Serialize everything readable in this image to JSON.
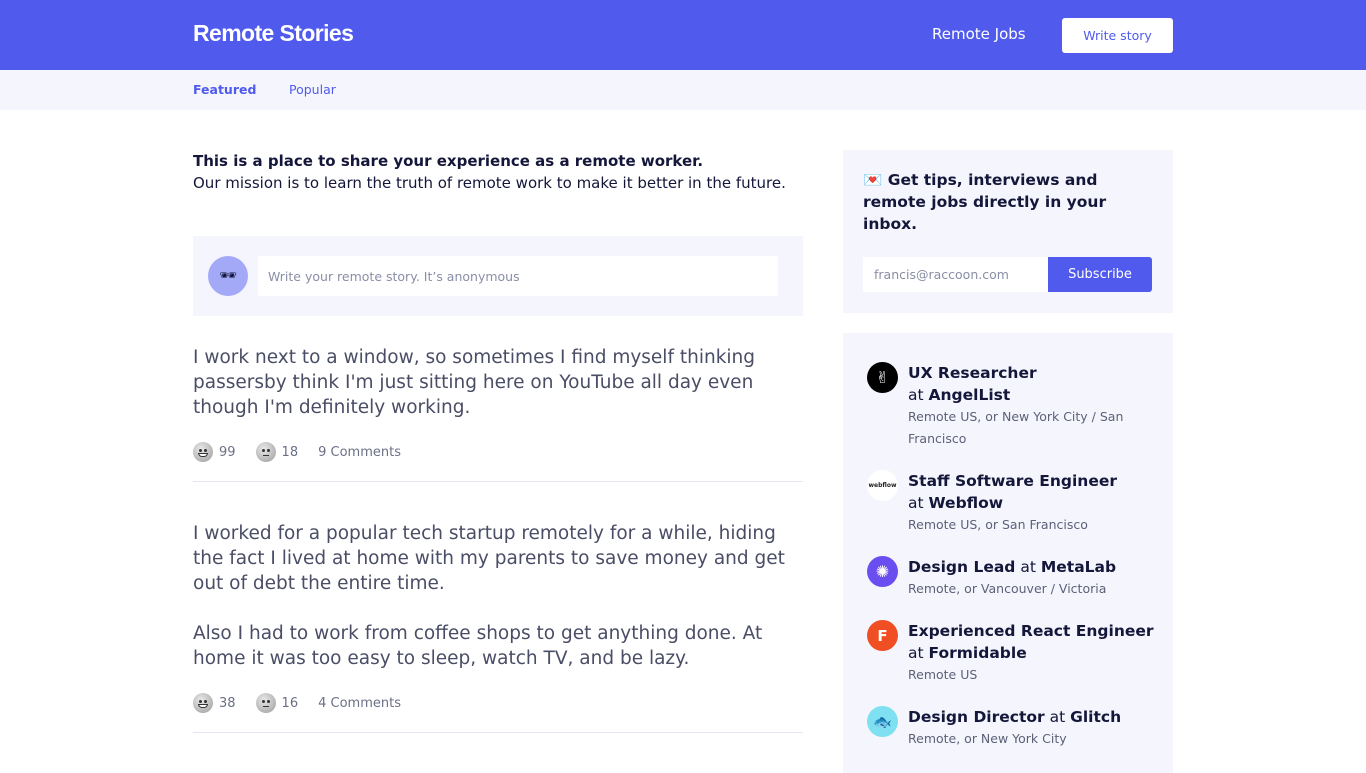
{
  "header": {
    "logo": "Remote Stories",
    "nav_jobs": "Remote Jobs",
    "write_story": "Write story",
    "brand_color": "#505bee"
  },
  "subnav": {
    "tabs": [
      {
        "label": "Featured",
        "active": true
      },
      {
        "label": "Popular",
        "active": false
      }
    ]
  },
  "intro": {
    "headline": "This is a place to share your experience as a remote worker.",
    "mission": "Our mission is to learn the truth of remote work to make it better in the future."
  },
  "composer": {
    "avatar_icon": "sunglasses-icon",
    "avatar_glyph": "🕶",
    "placeholder": "Write your remote story. It’s anonymous"
  },
  "stories": [
    {
      "paragraphs": [
        "I work next to a window, so sometimes I find myself thinking passersby think I'm just sitting here on YouTube all day even though I'm definitely working."
      ],
      "happy": "99",
      "meh": "18",
      "comments": "9 Comments"
    },
    {
      "paragraphs": [
        "I worked for a popular tech startup remotely for a while, hiding the fact I lived at home with my parents to save money and get out of debt the entire time.",
        "Also I had to work from coffee shops to get anything done. At home it was too easy to sleep, watch TV, and be lazy."
      ],
      "happy": "38",
      "meh": "16",
      "comments": "4 Comments"
    }
  ],
  "newsletter": {
    "icon": "love-letter-icon",
    "glyph": "💌",
    "heading": "Get tips, interviews and remote jobs directly in your inbox.",
    "email_placeholder": "francis@raccoon.com",
    "subscribe": "Subscribe"
  },
  "jobs": [
    {
      "role": "UX Researcher",
      "at": "at",
      "company": "AngelList",
      "location": "Remote US, or New York City / San Francisco",
      "logo_bg": "#000000",
      "logo_glyph": "✌"
    },
    {
      "role": "Staff Software Engineer",
      "at": "at",
      "company": "Webflow",
      "location": "Remote US, or San Francisco",
      "logo_bg": "#ffffff",
      "logo_glyph": "webflow"
    },
    {
      "role": "Design Lead",
      "at": "at",
      "company": "MetaLab",
      "location": "Remote, or Vancouver / Victoria",
      "logo_bg": "#6b4ef0",
      "logo_glyph": "✺"
    },
    {
      "role": "Experienced React Engineer",
      "at": "at",
      "company": "Formidable",
      "location": "Remote US",
      "logo_bg": "#f04e23",
      "logo_glyph": "F"
    },
    {
      "role": "Design Director",
      "at": "at",
      "company": "Glitch",
      "location": "Remote, or New York City",
      "logo_bg": "#7ee0f0",
      "logo_glyph": "🐟"
    }
  ]
}
